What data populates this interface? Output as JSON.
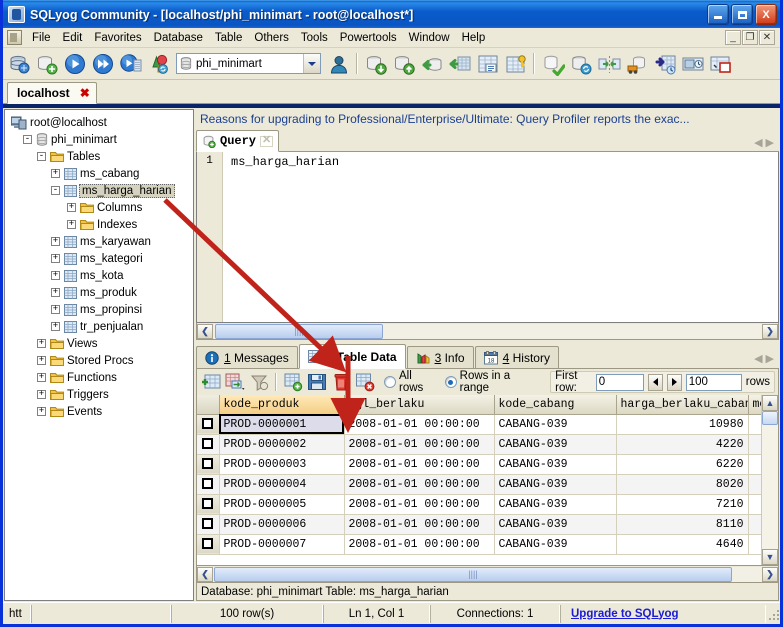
{
  "window": {
    "title": "SQLyog Community - [localhost/phi_minimart - root@localhost*]",
    "minimize_label": "",
    "maximize_label": "",
    "close_label": "X",
    "mdi_minimize": "_",
    "mdi_restore": "❐",
    "mdi_close": "✕"
  },
  "menubar": {
    "items": [
      {
        "label": "File"
      },
      {
        "label": "Edit"
      },
      {
        "label": "Favorites"
      },
      {
        "label": "Database"
      },
      {
        "label": "Table"
      },
      {
        "label": "Others"
      },
      {
        "label": "Tools"
      },
      {
        "label": "Powertools"
      },
      {
        "label": "Window"
      },
      {
        "label": "Help"
      }
    ]
  },
  "toolbar": {
    "database_combo": {
      "value": "phi_minimart",
      "icon": "database-icon"
    },
    "buttons": [
      {
        "name": "new-connection-icon"
      },
      {
        "name": "new-object-icon"
      },
      {
        "name": "execute-query-icon"
      },
      {
        "name": "execute-all-queries-icon"
      },
      {
        "name": "execute-query-current-icon"
      },
      {
        "name": "refresh-objects-icon"
      }
    ],
    "buttons_right": [
      {
        "name": "user-manager-icon"
      },
      {
        "name": "database-refresh-icon"
      },
      {
        "name": "import-external-data-icon"
      },
      {
        "name": "export-data-icon"
      },
      {
        "name": "restore-from-backup-icon"
      },
      {
        "name": "backup-database-icon"
      },
      {
        "name": "table-diagnostics-icon"
      },
      {
        "name": "table-key-icon"
      },
      {
        "name": "flush-icon"
      },
      {
        "name": "database-sync-icon"
      },
      {
        "name": "schema-sync-icon"
      },
      {
        "name": "data-sync-icon"
      },
      {
        "name": "migration-icon"
      },
      {
        "name": "scheduled-backup-icon"
      },
      {
        "name": "query-builder-icon"
      }
    ]
  },
  "connection_tabs": [
    {
      "label": "localhost",
      "close": "✖",
      "active": true
    }
  ],
  "tree": {
    "nodes": [
      {
        "label": "root@localhost",
        "icon": "server-icon",
        "indent": 0,
        "expander": "",
        "selected": false
      },
      {
        "label": "phi_minimart",
        "icon": "database-icon",
        "indent": 1,
        "expander": "-",
        "selected": false
      },
      {
        "label": "Tables",
        "icon": "folder-icon",
        "indent": 2,
        "expander": "-",
        "selected": false
      },
      {
        "label": "ms_cabang",
        "icon": "table-icon",
        "indent": 3,
        "expander": "+",
        "selected": false
      },
      {
        "label": "ms_harga_harian",
        "icon": "table-icon",
        "indent": 3,
        "expander": "-",
        "selected": true
      },
      {
        "label": "Columns",
        "icon": "folder-icon",
        "indent": 4,
        "expander": "+",
        "selected": false
      },
      {
        "label": "Indexes",
        "icon": "folder-icon",
        "indent": 4,
        "expander": "+",
        "selected": false
      },
      {
        "label": "ms_karyawan",
        "icon": "table-icon",
        "indent": 3,
        "expander": "+",
        "selected": false
      },
      {
        "label": "ms_kategori",
        "icon": "table-icon",
        "indent": 3,
        "expander": "+",
        "selected": false
      },
      {
        "label": "ms_kota",
        "icon": "table-icon",
        "indent": 3,
        "expander": "+",
        "selected": false
      },
      {
        "label": "ms_produk",
        "icon": "table-icon",
        "indent": 3,
        "expander": "+",
        "selected": false
      },
      {
        "label": "ms_propinsi",
        "icon": "table-icon",
        "indent": 3,
        "expander": "+",
        "selected": false
      },
      {
        "label": "tr_penjualan",
        "icon": "table-icon",
        "indent": 3,
        "expander": "+",
        "selected": false
      },
      {
        "label": "Views",
        "icon": "folder-icon",
        "indent": 2,
        "expander": "+",
        "selected": false
      },
      {
        "label": "Stored Procs",
        "icon": "folder-icon",
        "indent": 2,
        "expander": "+",
        "selected": false
      },
      {
        "label": "Functions",
        "icon": "folder-icon",
        "indent": 2,
        "expander": "+",
        "selected": false
      },
      {
        "label": "Triggers",
        "icon": "folder-icon",
        "indent": 2,
        "expander": "+",
        "selected": false
      },
      {
        "label": "Events",
        "icon": "folder-icon",
        "indent": 2,
        "expander": "+",
        "selected": false
      }
    ]
  },
  "upgrade_banner": {
    "text": "Reasons for upgrading to Professional/Enterprise/Ultimate: Query Profiler reports the exac..."
  },
  "query_panel": {
    "tab_label": "Query",
    "tab_close": "✕",
    "line_number": "1",
    "sql": "ms_harga_harian",
    "nav_prev": "◀",
    "nav_next": "▶"
  },
  "result_tabs": [
    {
      "num": "1",
      "label": "Messages",
      "icon": "info-icon",
      "active": false
    },
    {
      "num": "2",
      "label": "Table Data",
      "icon": "grid-icon",
      "active": true
    },
    {
      "num": "3",
      "label": "Info",
      "icon": "chart-icon",
      "active": false
    },
    {
      "num": "4",
      "label": "History",
      "icon": "calendar-icon",
      "active": false
    }
  ],
  "grid_toolbar": {
    "buttons": [
      {
        "name": "insert-row-icon"
      },
      {
        "name": "duplicate-row-icon"
      },
      {
        "name": "filter-icon"
      },
      {
        "name": "refresh-data-icon"
      },
      {
        "name": "save-changes-icon"
      },
      {
        "name": "delete-row-icon"
      },
      {
        "name": "cancel-changes-icon"
      }
    ],
    "all_rows_label": "All rows",
    "all_rows_selected": false,
    "range_rows_label": "Rows in a range",
    "range_rows_selected": true,
    "first_row_label": "First row:",
    "first_row_value": "0",
    "limit_value": "100",
    "rows_suffix": "rows",
    "spin_left": "◀",
    "spin_right": "▶"
  },
  "data_grid": {
    "columns": [
      "kode_produk",
      "tgl_berlaku",
      "kode_cabang",
      "harga_berlaku_cabang",
      "mo"
    ],
    "highlighted_column": "kode_produk",
    "rows": [
      {
        "kode_produk": "PROD-0000001",
        "tgl_berlaku": "2008-01-01 00:00:00",
        "kode_cabang": "CABANG-039",
        "harga_berlaku_cabang": "10980",
        "mo": ""
      },
      {
        "kode_produk": "PROD-0000002",
        "tgl_berlaku": "2008-01-01 00:00:00",
        "kode_cabang": "CABANG-039",
        "harga_berlaku_cabang": "4220",
        "mo": ""
      },
      {
        "kode_produk": "PROD-0000003",
        "tgl_berlaku": "2008-01-01 00:00:00",
        "kode_cabang": "CABANG-039",
        "harga_berlaku_cabang": "6220",
        "mo": ""
      },
      {
        "kode_produk": "PROD-0000004",
        "tgl_berlaku": "2008-01-01 00:00:00",
        "kode_cabang": "CABANG-039",
        "harga_berlaku_cabang": "8020",
        "mo": ""
      },
      {
        "kode_produk": "PROD-0000005",
        "tgl_berlaku": "2008-01-01 00:00:00",
        "kode_cabang": "CABANG-039",
        "harga_berlaku_cabang": "7210",
        "mo": ""
      },
      {
        "kode_produk": "PROD-0000006",
        "tgl_berlaku": "2008-01-01 00:00:00",
        "kode_cabang": "CABANG-039",
        "harga_berlaku_cabang": "8110",
        "mo": ""
      },
      {
        "kode_produk": "PROD-0000007",
        "tgl_berlaku": "2008-01-01 00:00:00",
        "kode_cabang": "CABANG-039",
        "harga_berlaku_cabang": "4640",
        "mo": ""
      }
    ],
    "scroll_left": "❮",
    "scroll_right": "❯",
    "scroll_up": "▲",
    "scroll_down": "▼"
  },
  "db_status": {
    "text": "Database: phi_minimart Table: ms_harga_harian"
  },
  "statusbar": {
    "cells": [
      {
        "text": "htt",
        "name": "status-url"
      },
      {
        "text": "",
        "name": "status-empty"
      },
      {
        "text": "100 row(s)",
        "name": "status-rowcount"
      },
      {
        "text": "Ln 1, Col 1",
        "name": "status-caret"
      },
      {
        "text": "Connections: 1",
        "name": "status-connections"
      }
    ],
    "upgrade_link": "Upgrade to SQLyog"
  },
  "annotations": {
    "arrow1_name": "red-arrow-tree-to-table-data",
    "arrow2_name": "red-arrow-to-tgl-berlaku-column",
    "color": "#c0231a"
  }
}
